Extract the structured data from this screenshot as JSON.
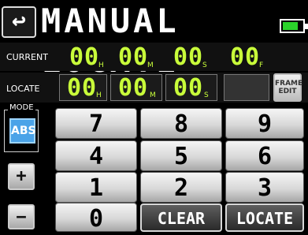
{
  "title": "MANUAL LOCATE",
  "back_icon": "↩",
  "battery": {
    "level": 0.8,
    "color": "#2bd42b"
  },
  "current": {
    "label": "CURRENT",
    "fields": [
      {
        "value": "00",
        "unit": "H"
      },
      {
        "value": "00",
        "unit": "M"
      },
      {
        "value": "00",
        "unit": "S"
      },
      {
        "value": "00",
        "unit": "F"
      }
    ]
  },
  "locate": {
    "label": "LOCATE",
    "fields": [
      {
        "value": "00",
        "unit": "H"
      },
      {
        "value": "00",
        "unit": "M"
      },
      {
        "value": "00",
        "unit": "S"
      }
    ],
    "frame_edit_label": "FRAME EDIT"
  },
  "mode": {
    "label": "MODE",
    "selected": "ABS",
    "plus_label": "+",
    "minus_label": "−"
  },
  "keypad": {
    "keys": [
      "7",
      "8",
      "9",
      "4",
      "5",
      "6",
      "1",
      "2",
      "3",
      "0"
    ],
    "clear_label": "CLEAR",
    "locate_label": "LOCATE"
  },
  "colors": {
    "digits": "#c9ff3a",
    "mode_selected": "#4aa3e8"
  }
}
